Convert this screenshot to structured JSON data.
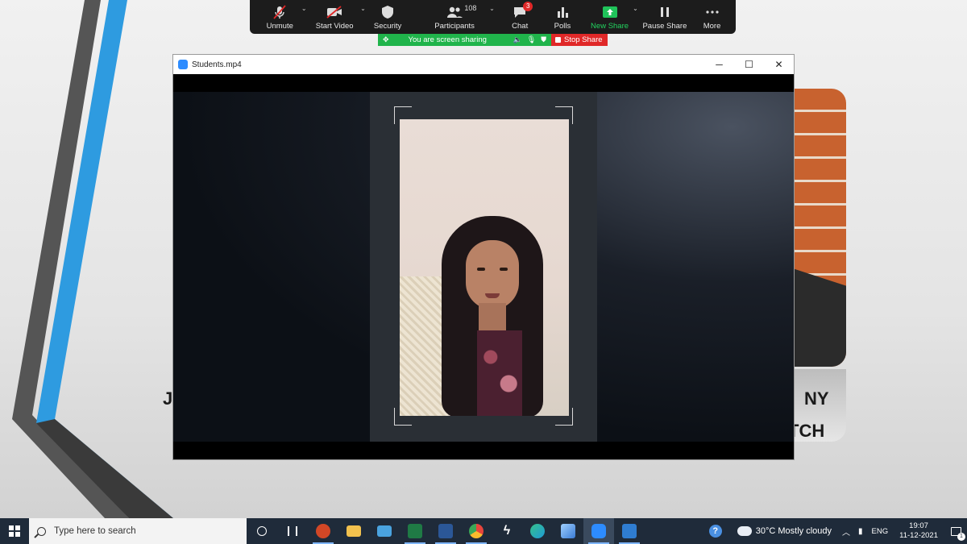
{
  "zoom_toolbar": {
    "items": [
      {
        "label": "Unmute",
        "icon": "microphone-muted-icon",
        "has_caret": true
      },
      {
        "label": "Start Video",
        "icon": "video-off-icon",
        "has_caret": true
      },
      {
        "label": "Security",
        "icon": "shield-icon"
      },
      {
        "label": "Participants",
        "icon": "participants-icon",
        "count": "108",
        "has_caret": true
      },
      {
        "label": "Chat",
        "icon": "chat-bubble-icon",
        "badge": "3"
      },
      {
        "label": "Polls",
        "icon": "bar-chart-icon"
      },
      {
        "label": "New Share",
        "icon": "share-screen-icon",
        "has_caret": true
      },
      {
        "label": "Pause Share",
        "icon": "pause-icon"
      },
      {
        "label": "More",
        "icon": "more-dots-icon"
      }
    ],
    "colors": {
      "background": "#1c1c1c",
      "new_share": "#20c35a",
      "badge": "#e02828"
    }
  },
  "share_banner": {
    "text": "You are screen sharing",
    "stop_label": "Stop Share",
    "colors": {
      "banner": "#20b44b",
      "stop": "#e02828"
    }
  },
  "slide": {
    "left_text": "J",
    "right_text_1": "NY",
    "right_text_2": "TCH",
    "accent_color": "#2e9be0"
  },
  "video_window": {
    "title": "Students.mp4",
    "controls": {
      "minimize": "─",
      "maximize": "☐",
      "close": "✕"
    }
  },
  "taskbar": {
    "search_placeholder": "Type here to search",
    "apps": [
      {
        "name": "task-view-icon",
        "color": "#ffffff"
      },
      {
        "name": "widgets-icon",
        "color": "#ffffff"
      },
      {
        "name": "powerpoint-icon",
        "color": "#d24726"
      },
      {
        "name": "file-explorer-icon",
        "color": "#f2c14e"
      },
      {
        "name": "control-panel-icon",
        "color": "#4aa3df"
      },
      {
        "name": "excel-icon",
        "color": "#1f7a45"
      },
      {
        "name": "word-icon",
        "color": "#2b5797"
      },
      {
        "name": "chrome-icon",
        "color": "#e8453c"
      },
      {
        "name": "app-lightning-icon",
        "color": "#ffffff"
      },
      {
        "name": "edge-icon",
        "color": "#1e9bd7"
      },
      {
        "name": "photos-icon",
        "color": "#3a7bd5"
      },
      {
        "name": "zoom-icon",
        "color": "#2d8cff"
      },
      {
        "name": "media-player-icon",
        "color": "#2f7dd1"
      }
    ],
    "tray": {
      "help_icon": "help-icon",
      "weather": "30°C  Mostly cloudy",
      "language": "ENG",
      "time": "19:07",
      "date": "11-12-2021",
      "notifications": "1"
    }
  }
}
